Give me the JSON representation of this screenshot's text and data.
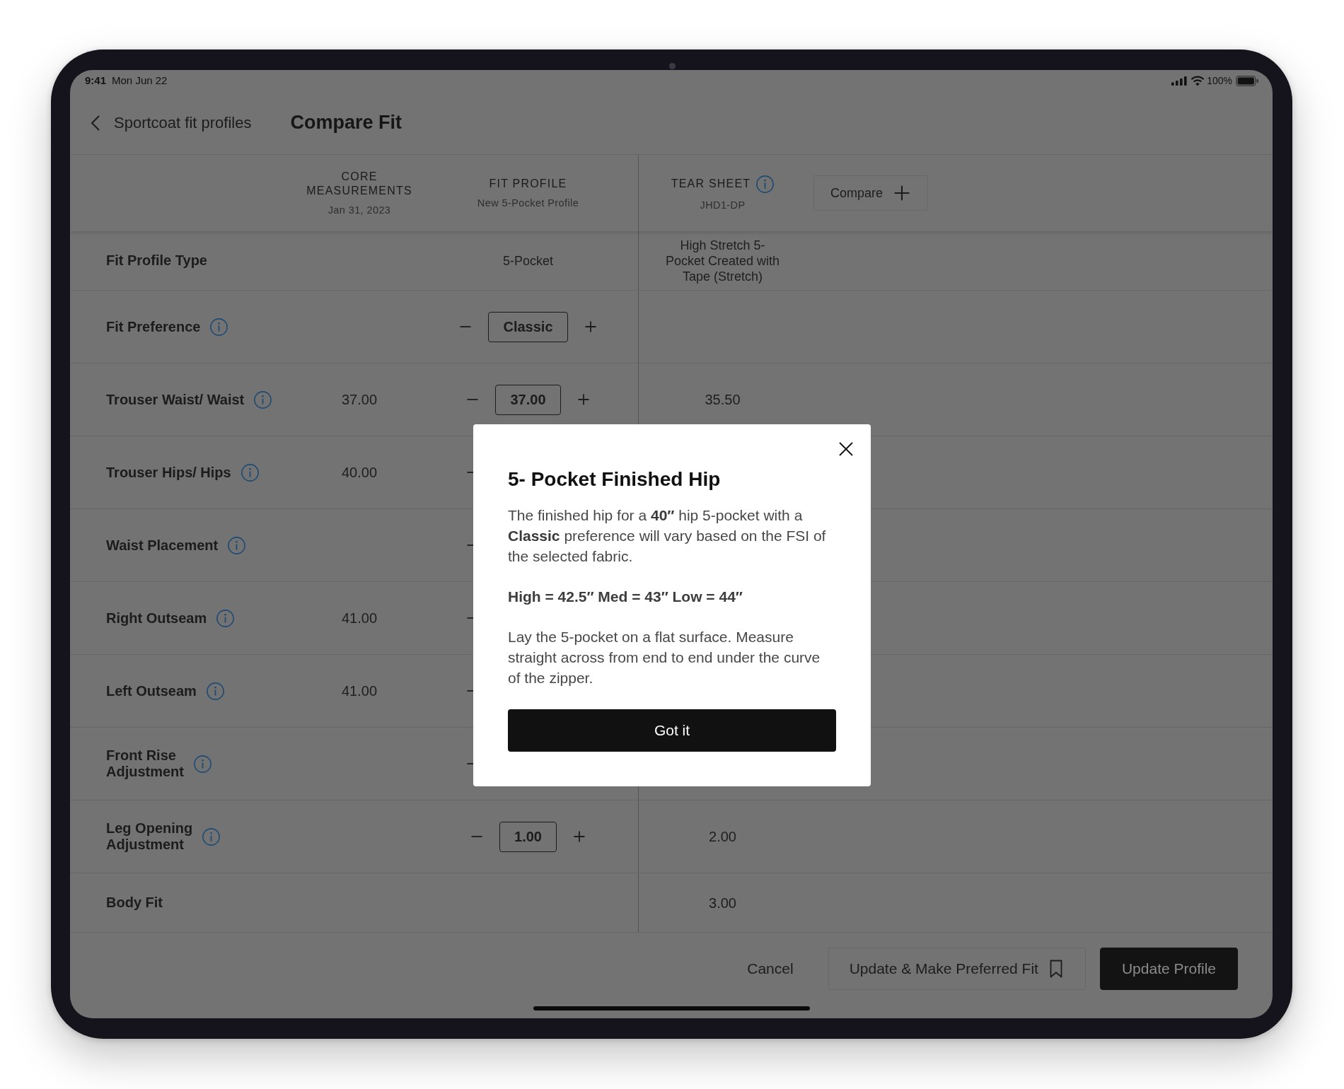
{
  "status_bar": {
    "time": "9:41",
    "date": "Mon Jun 22",
    "battery": "100%"
  },
  "nav": {
    "back_label": "Sportcoat fit profiles",
    "title": "Compare Fit"
  },
  "columns": [
    {
      "title": "CORE MEASUREMENTS",
      "subtitle": "Jan 31, 2023",
      "info": false
    },
    {
      "title": "FIT PROFILE",
      "subtitle": "New 5-Pocket Profile",
      "info": false
    },
    {
      "title": "TEAR SHEET",
      "subtitle": "JHD1-DP",
      "info": true
    }
  ],
  "compare_button": {
    "label": "Compare"
  },
  "rows": [
    {
      "label": "Fit Profile Type",
      "info": false,
      "fit_profile": {
        "kind": "text",
        "value": "5-Pocket"
      },
      "tear_sheet": "High Stretch 5-Pocket Created with Tape (Stretch)"
    },
    {
      "label": "Fit Preference",
      "info": true,
      "fit_profile": {
        "kind": "stepper",
        "value": "Classic"
      }
    },
    {
      "label": "Trouser Waist/ Waist",
      "info": true,
      "core": "37.00",
      "fit_profile": {
        "kind": "stepper",
        "value": "37.00"
      },
      "tear_sheet": "35.50"
    },
    {
      "label": "Trouser Hips/ Hips",
      "info": true,
      "core": "40.00",
      "fit_profile": {
        "kind": "stepper"
      }
    },
    {
      "label": "Waist Placement",
      "info": true,
      "fit_profile": {
        "kind": "stepper"
      }
    },
    {
      "label": "Right Outseam",
      "info": true,
      "core": "41.00",
      "fit_profile": {
        "kind": "stepper"
      }
    },
    {
      "label": "Left Outseam",
      "info": true,
      "core": "41.00",
      "fit_profile": {
        "kind": "stepper"
      }
    },
    {
      "label": "Front Rise\nAdjustment",
      "info": true,
      "fit_profile": {
        "kind": "stepper"
      }
    },
    {
      "label": "Leg Opening\nAdjustment",
      "info": true,
      "fit_profile": {
        "kind": "stepper",
        "value": "1.00"
      },
      "tear_sheet": "2.00"
    },
    {
      "label": "Body Fit",
      "info": false,
      "tear_sheet": "3.00"
    }
  ],
  "footer": {
    "buttons": [
      {
        "kind": "link",
        "label": "Cancel"
      },
      {
        "kind": "outline",
        "label": "Update & Make Preferred Fit"
      },
      {
        "kind": "solid",
        "label": "Update Profile"
      }
    ]
  },
  "modal": {
    "title": "5- Pocket Finished Hip",
    "paragraphs": [
      {
        "kind": "body",
        "text": "The finished hip for a **40″** hip 5-pocket with a **Classic** preference will vary based on the FSI of the selected fabric."
      },
      {
        "kind": "emphasis",
        "text": "High = 42.5″ Med = 43″ Low = 44″"
      },
      {
        "kind": "body",
        "text": "Lay the 5-pocket on a flat surface. Measure straight across from end to end under the curve of the zipper."
      }
    ],
    "button": "Got it"
  }
}
